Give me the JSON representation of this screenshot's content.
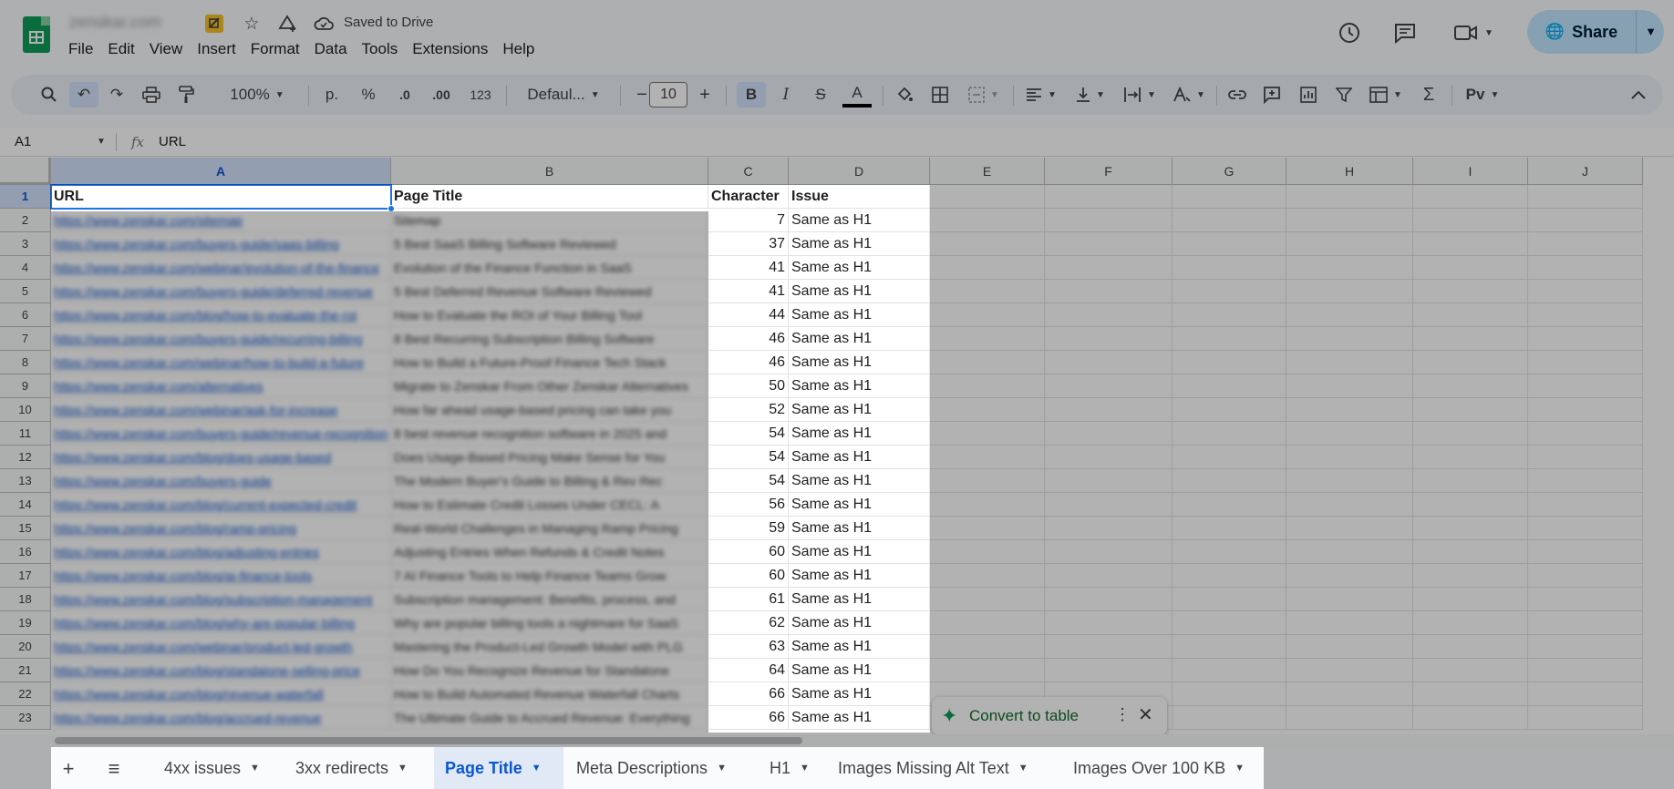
{
  "app": {
    "doc_title": "zenskar.com",
    "saved_status": "Saved to Drive",
    "share_label": "Share"
  },
  "menu": [
    "File",
    "Edit",
    "View",
    "Insert",
    "Format",
    "Data",
    "Tools",
    "Extensions",
    "Help"
  ],
  "toolbar": {
    "zoom": "100%",
    "format_p": "p.",
    "percent": "%",
    "dec_decrease": ".0",
    "dec_increase": ".00",
    "more_formats": "123",
    "font": "Defaul...",
    "font_size": "10",
    "bold": "B",
    "italic": "I",
    "strike": "S",
    "text_color": "A"
  },
  "formula_bar": {
    "name_box": "A1",
    "fx": "fx",
    "content": "URL"
  },
  "columns": [
    "A",
    "B",
    "C",
    "D",
    "E",
    "F",
    "G",
    "H",
    "I",
    "J"
  ],
  "rows": [
    "1",
    "2",
    "3",
    "4",
    "5",
    "6",
    "7",
    "8",
    "9",
    "10",
    "11",
    "12",
    "13",
    "14",
    "15",
    "16",
    "17",
    "18",
    "19",
    "20",
    "21",
    "22",
    "23"
  ],
  "header_row": {
    "a": "URL",
    "b": "Page Title",
    "c": "Character",
    "d": "Issue"
  },
  "table_rows": [
    {
      "url": "https://www.zenskar.com/sitemap",
      "title": "Sitemap",
      "chars": "7",
      "issue": "Same as H1"
    },
    {
      "url": "https://www.zenskar.com/buyers-guide/saas-billing",
      "title": "5 Best SaaS Billing Software Reviewed",
      "chars": "37",
      "issue": "Same as H1"
    },
    {
      "url": "https://www.zenskar.com/webinar/evolution-of-the-finance",
      "title": "Evolution of the Finance Function in SaaS",
      "chars": "41",
      "issue": "Same as H1"
    },
    {
      "url": "https://www.zenskar.com/buyers-guide/deferred-revenue",
      "title": "5 Best Deferred Revenue Software Reviewed",
      "chars": "41",
      "issue": "Same as H1"
    },
    {
      "url": "https://www.zenskar.com/blog/how-to-evaluate-the-roi",
      "title": "How to Evaluate the ROI of Your Billing Tool",
      "chars": "44",
      "issue": "Same as H1"
    },
    {
      "url": "https://www.zenskar.com/buyers-guide/recurring-billing",
      "title": "8 Best Recurring Subscription Billing Software",
      "chars": "46",
      "issue": "Same as H1"
    },
    {
      "url": "https://www.zenskar.com/webinar/how-to-build-a-future",
      "title": "How to Build a Future-Proof Finance Tech Stack",
      "chars": "46",
      "issue": "Same as H1"
    },
    {
      "url": "https://www.zenskar.com/alternatives",
      "title": "Migrate to Zenskar From Other Zenskar Alternatives",
      "chars": "50",
      "issue": "Same as H1"
    },
    {
      "url": "https://www.zenskar.com/webinar/ask-for-increase",
      "title": "How far ahead usage-based pricing can take you",
      "chars": "52",
      "issue": "Same as H1"
    },
    {
      "url": "https://www.zenskar.com/buyers-guide/revenue-recognition",
      "title": "8 best revenue recognition software in 2025 and",
      "chars": "54",
      "issue": "Same as H1"
    },
    {
      "url": "https://www.zenskar.com/blog/does-usage-based",
      "title": "Does Usage-Based Pricing Make Sense for You",
      "chars": "54",
      "issue": "Same as H1"
    },
    {
      "url": "https://www.zenskar.com/buyers-guide",
      "title": "The Modern Buyer's Guide to Billing & Rev Rec",
      "chars": "54",
      "issue": "Same as H1"
    },
    {
      "url": "https://www.zenskar.com/blog/current-expected-credit",
      "title": "How to Estimate Credit Losses Under CECL: A",
      "chars": "56",
      "issue": "Same as H1"
    },
    {
      "url": "https://www.zenskar.com/blog/ramp-pricing",
      "title": "Real-World Challenges in Managing Ramp Pricing",
      "chars": "59",
      "issue": "Same as H1"
    },
    {
      "url": "https://www.zenskar.com/blog/adjusting-entries",
      "title": "Adjusting Entries When Refunds & Credit Notes",
      "chars": "60",
      "issue": "Same as H1"
    },
    {
      "url": "https://www.zenskar.com/blog/ai-finance-tools",
      "title": "7 AI Finance Tools to Help Finance Teams Grow",
      "chars": "60",
      "issue": "Same as H1"
    },
    {
      "url": "https://www.zenskar.com/blog/subscription-management",
      "title": "Subscription management: Benefits, process, and",
      "chars": "61",
      "issue": "Same as H1"
    },
    {
      "url": "https://www.zenskar.com/blog/why-are-popular-billing",
      "title": "Why are popular billing tools a nightmare for SaaS",
      "chars": "62",
      "issue": "Same as H1"
    },
    {
      "url": "https://www.zenskar.com/webinar/product-led-growth",
      "title": "Mastering the Product-Led Growth Model with PLG",
      "chars": "63",
      "issue": "Same as H1"
    },
    {
      "url": "https://www.zenskar.com/blog/standalone-selling-price",
      "title": "How Do You Recognize Revenue for Standalone",
      "chars": "64",
      "issue": "Same as H1"
    },
    {
      "url": "https://www.zenskar.com/blog/revenue-waterfall",
      "title": "How to Build Automated Revenue Waterfall Charts",
      "chars": "66",
      "issue": "Same as H1"
    },
    {
      "url": "https://www.zenskar.com/blog/accrued-revenue",
      "title": "The Ultimate Guide to Accrued Revenue: Everything",
      "chars": "66",
      "issue": "Same as H1"
    }
  ],
  "toast": {
    "label": "Convert to table"
  },
  "sheets": [
    {
      "label": "4xx issues"
    },
    {
      "label": "3xx redirects"
    },
    {
      "label": "Page Title"
    },
    {
      "label": "Meta Descriptions"
    },
    {
      "label": "H1"
    },
    {
      "label": "Images Missing Alt Text"
    },
    {
      "label": "Images Over 100 KB"
    }
  ],
  "colors": {
    "accent": "#0b57d0",
    "share_bg": "#c2e7ff",
    "sheets_green": "#0f9d58",
    "link": "#1155cc"
  }
}
